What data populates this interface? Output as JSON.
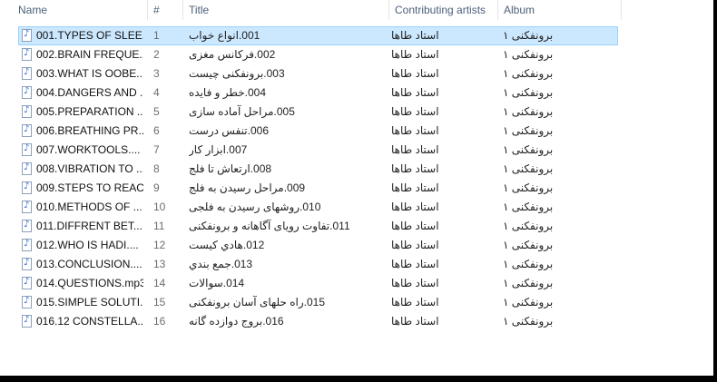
{
  "columns": {
    "name": "Name",
    "number": "#",
    "title": "Title",
    "artists": "Contributing artists",
    "album": "Album"
  },
  "rows": [
    {
      "name": "001.TYPES OF SLEE...",
      "number": "1",
      "title": "001.انواع خواب",
      "artist": "استاد طاها",
      "album": "برونفکنی ۱",
      "selected": true
    },
    {
      "name": "002.BRAIN FREQUE...",
      "number": "2",
      "title": "002.فرکانس مغزی",
      "artist": "استاد طاها",
      "album": "برونفکنی ۱"
    },
    {
      "name": "003.WHAT IS OOBE...",
      "number": "3",
      "title": "003.برونفکنی چیست",
      "artist": "استاد طاها",
      "album": "برونفکنی ۱"
    },
    {
      "name": "004.DANGERS AND ...",
      "number": "4",
      "title": "004.خطر و فایده",
      "artist": "استاد طاها",
      "album": "برونفکنی ۱"
    },
    {
      "name": "005.PREPARATION ...",
      "number": "5",
      "title": "005.مراحل آماده سازی",
      "artist": "استاد طاها",
      "album": "برونفکنی ۱"
    },
    {
      "name": "006.BREATHING PR...",
      "number": "6",
      "title": "006.تنفس درست",
      "artist": "استاد طاها",
      "album": "برونفکنی ۱"
    },
    {
      "name": "007.WORKTOOLS....",
      "number": "7",
      "title": "007.ابزار کار",
      "artist": "استاد طاها",
      "album": "برونفکنی ۱"
    },
    {
      "name": "008.VIBRATION TO ...",
      "number": "8",
      "title": "008.ارتعاش تا فلج",
      "artist": "استاد طاها",
      "album": "برونفکنی ۱"
    },
    {
      "name": "009.STEPS TO REAC...",
      "number": "9",
      "title": "009.مراحل رسیدن به فلج",
      "artist": "استاد طاها",
      "album": "برونفکنی ۱"
    },
    {
      "name": "010.METHODS OF ...",
      "number": "10",
      "title": "010.روشهای رسیدن به فلجی",
      "artist": "استاد طاها",
      "album": "برونفکنی ۱"
    },
    {
      "name": "011.DIFFRENT BET...",
      "number": "11",
      "title": "011.تفاوت رویای آگاهانه و برونفکنی",
      "artist": "استاد طاها",
      "album": "برونفکنی ۱"
    },
    {
      "name": "012.WHO IS HADI....",
      "number": "12",
      "title": "012.هادي كيست",
      "artist": "استاد طاها",
      "album": "برونفکنی ۱"
    },
    {
      "name": "013.CONCLUSION....",
      "number": "13",
      "title": "013.جمع بندي",
      "artist": "استاد طاها",
      "album": "برونفکنی ۱"
    },
    {
      "name": "014.QUESTIONS.mp3",
      "number": "14",
      "title": "014.سوالات",
      "artist": "استاد طاها",
      "album": "برونفکنی ۱"
    },
    {
      "name": "015.SIMPLE SOLUTI...",
      "number": "15",
      "title": "015.راه حلهای آسان برونفکنی",
      "artist": "استاد طاها",
      "album": "برونفکنی ۱"
    },
    {
      "name": "016.12 CONSTELLA...",
      "number": "16",
      "title": "016.بروج دوازده گانه",
      "artist": "استاد طاها",
      "album": "برونفکنی ۱"
    }
  ]
}
